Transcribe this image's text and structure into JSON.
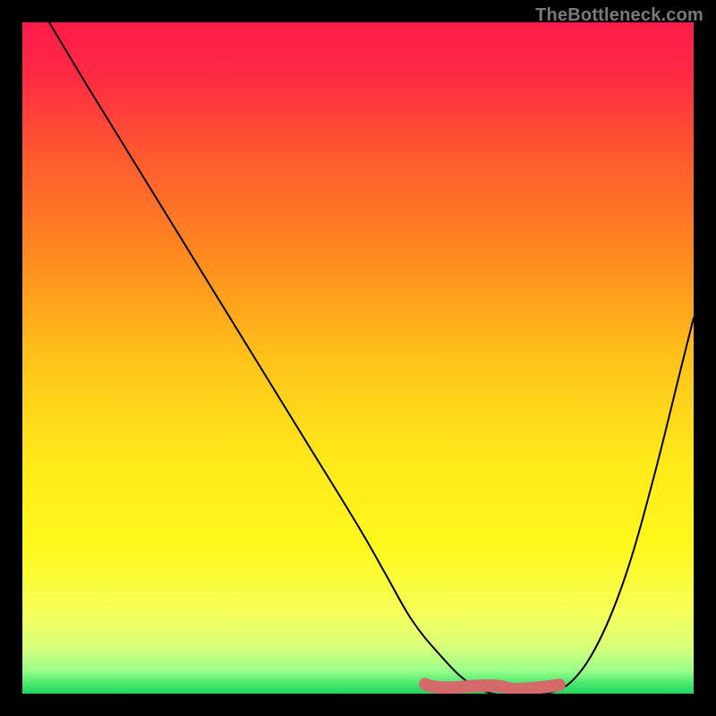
{
  "attribution": "TheBottleneck.com",
  "chart_data": {
    "type": "line",
    "title": "",
    "xlabel": "",
    "ylabel": "",
    "x_range": [
      0,
      100
    ],
    "y_range": [
      0,
      100
    ],
    "series": [
      {
        "name": "curve",
        "x": [
          4,
          10,
          18,
          26,
          34,
          42,
          50,
          54,
          58,
          62,
          66,
          70,
          74,
          78,
          82,
          86,
          90,
          94,
          98,
          100
        ],
        "y": [
          100,
          90,
          77,
          64,
          51,
          38,
          25,
          18,
          11,
          6,
          2,
          0,
          0,
          0,
          2,
          8,
          18,
          32,
          48,
          56
        ]
      }
    ],
    "flat_segment": {
      "x_start": 60,
      "x_end": 80,
      "y": 0
    },
    "gradient_stops": [
      {
        "offset": 0.0,
        "color": "#ff1b4b"
      },
      {
        "offset": 0.08,
        "color": "#ff2a44"
      },
      {
        "offset": 0.2,
        "color": "#ff5a2f"
      },
      {
        "offset": 0.35,
        "color": "#ff8a1f"
      },
      {
        "offset": 0.5,
        "color": "#ffc21a"
      },
      {
        "offset": 0.65,
        "color": "#ffe81a"
      },
      {
        "offset": 0.78,
        "color": "#fff81c"
      },
      {
        "offset": 0.88,
        "color": "#f6ff5a"
      },
      {
        "offset": 0.93,
        "color": "#d8ff7a"
      },
      {
        "offset": 0.965,
        "color": "#9cff8a"
      },
      {
        "offset": 0.985,
        "color": "#4be86e"
      },
      {
        "offset": 1.0,
        "color": "#1fd65f"
      }
    ],
    "marker_color": "#d46a6a",
    "marker_width": 14
  }
}
